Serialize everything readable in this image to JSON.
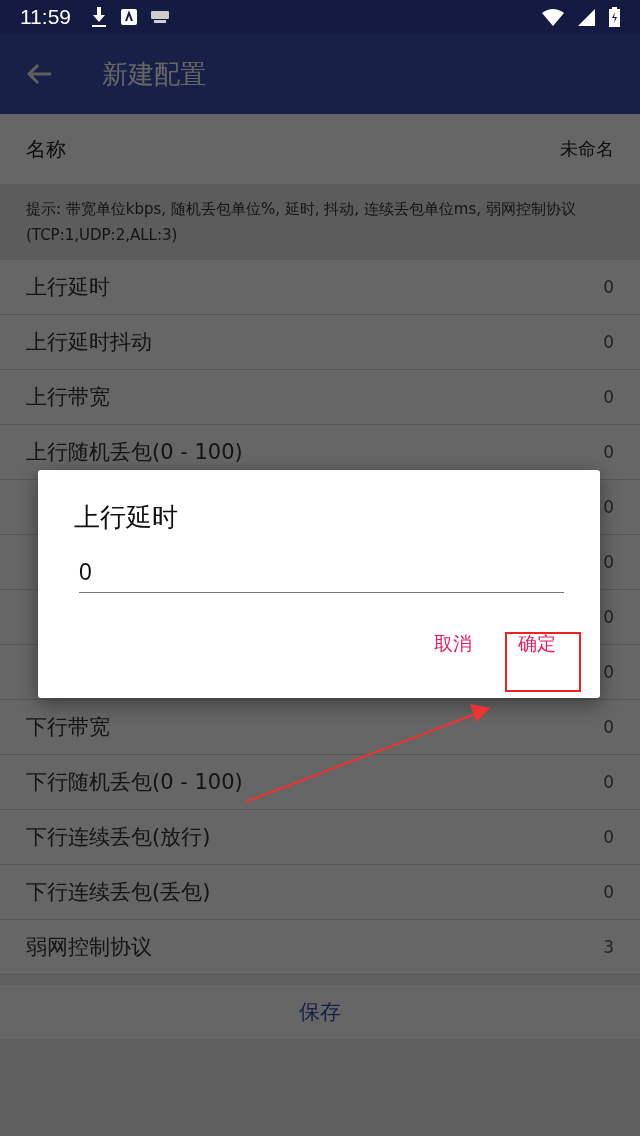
{
  "status_bar": {
    "time": "11:59"
  },
  "app_bar": {
    "title": "新建配置"
  },
  "name_row": {
    "label": "名称",
    "value": "未命名"
  },
  "hint": "提示: 带宽单位kbps, 随机丢包单位%, 延时, 抖动, 连续丢包单位ms, 弱网控制协议(TCP:1,UDP:2,ALL:3)",
  "rows": [
    {
      "label": "上行延时",
      "value": "0"
    },
    {
      "label": "上行延时抖动",
      "value": "0"
    },
    {
      "label": "上行带宽",
      "value": "0"
    },
    {
      "label": "上行随机丢包(0 - 100)",
      "value": "0"
    },
    {
      "value": "0"
    },
    {
      "value": "0"
    },
    {
      "value": "0"
    },
    {
      "value": "0"
    },
    {
      "label": "下行带宽",
      "value": "0"
    },
    {
      "label": "下行随机丢包(0 - 100)",
      "value": "0"
    },
    {
      "label": "下行连续丢包(放行)",
      "value": "0"
    },
    {
      "label": "下行连续丢包(丢包)",
      "value": "0"
    },
    {
      "label": "弱网控制协议",
      "value": "3"
    }
  ],
  "save_button": "保存",
  "dialog": {
    "title": "上行延时",
    "value": "0",
    "buttons": [
      "取消",
      "确定"
    ]
  }
}
